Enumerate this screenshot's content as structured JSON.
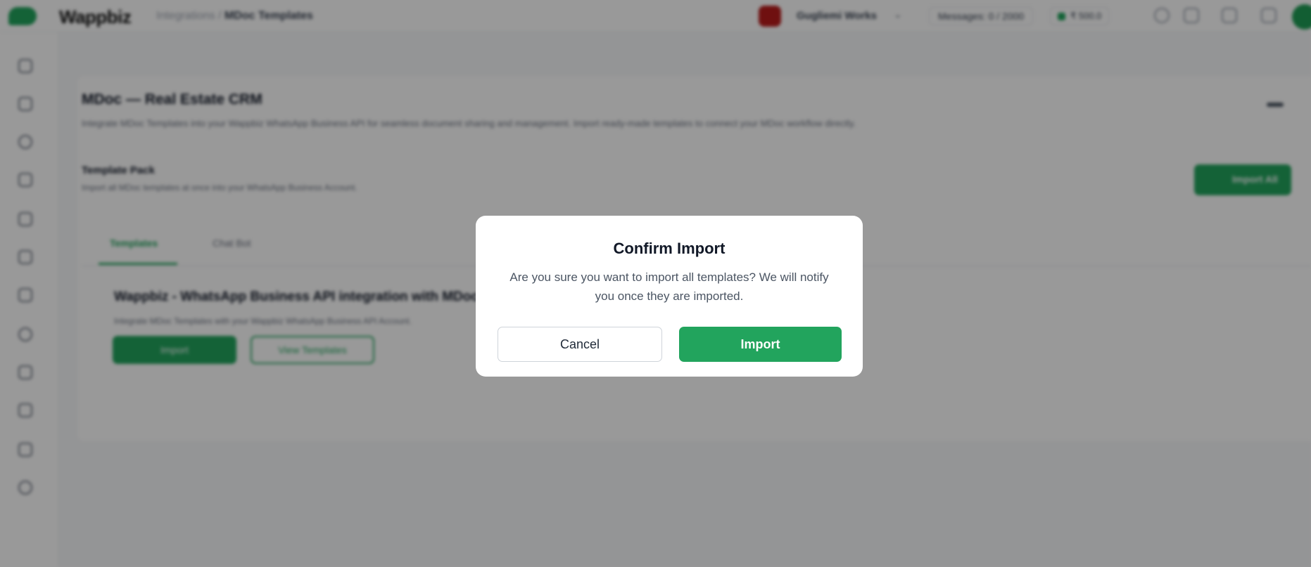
{
  "app": {
    "brand": "Wappbiz",
    "breadcrumb": {
      "parent": "Integrations",
      "separator": "/",
      "current": "MDoc Templates"
    },
    "user_name": "Gugliemi Works",
    "messages_label": "Messages: 0 / 2000",
    "credit_label": "₹ 500.0",
    "accent_color": "#22a45d",
    "topbar_icons": [
      "search-icon",
      "grid-icon",
      "help-icon",
      "bell-icon"
    ],
    "sidebar_icons": [
      "dashboard-icon",
      "chat-icon",
      "contacts-icon",
      "campaign-icon",
      "calendar-icon",
      "megaphone-icon",
      "flow-icon",
      "integrations-icon",
      "analytics-icon",
      "templates-icon",
      "bot-icon",
      "settings-icon"
    ]
  },
  "page": {
    "title": "MDoc — Real Estate CRM",
    "description": "Integrate MDoc Templates into your Wappbiz WhatsApp Business API for seamless document sharing and management. Import ready-made templates to connect your MDoc workflow directly.",
    "pack_title": "Template Pack",
    "pack_description": "Import all MDoc templates at once into your WhatsApp Business Account.",
    "import_all_label": "Import All",
    "tabs": [
      "Templates",
      "Chat Bot"
    ],
    "integration_title": "Wappbiz - WhatsApp Business API integration with MDoc",
    "integration_description": "Integrate MDoc Templates with your Wappbiz WhatsApp Business API Account.",
    "import_label": "Import",
    "view_templates_label": "View Templates"
  },
  "modal": {
    "title": "Confirm Import",
    "message": "Are you sure you want to import all templates? We will notify you once they are imported.",
    "cancel_label": "Cancel",
    "confirm_label": "Import"
  }
}
